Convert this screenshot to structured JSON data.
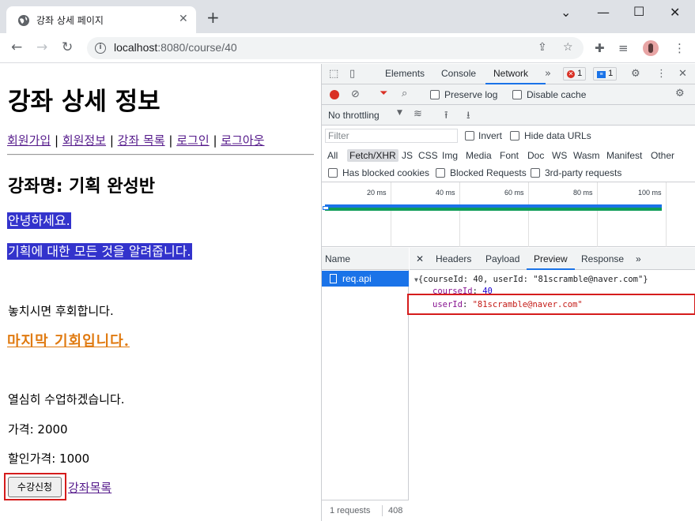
{
  "browser": {
    "tab_title": "강좌 상세 페이지",
    "url_host": "localhost",
    "url_rest": ":8080/course/40"
  },
  "page": {
    "title": "강좌 상세 정보",
    "nav": {
      "signup": "회원가입",
      "member_info": "회원정보",
      "course_list": "강좌 목록",
      "login": "로그인",
      "logout": "로그아웃",
      "separator": "|"
    },
    "course_name": "강좌명: 기획 완성반",
    "desc_line1": "안녕하세요.",
    "desc_line2": "기획에 대한 모든 것을 알려줍니다.",
    "desc_line3": "놓치시면 후회합니다.",
    "desc_emphasis": "마지막 기회입니다.",
    "desc_line4": "열심히 수업하겠습니다.",
    "price": "가격: 2000",
    "sale_price": "할인가격: 1000",
    "apply_button": "수강신청",
    "list_link": "강좌목록"
  },
  "devtools": {
    "tabs": [
      "Elements",
      "Console",
      "Network"
    ],
    "error_count": "1",
    "message_count": "1",
    "preserve_log": "Preserve log",
    "disable_cache": "Disable cache",
    "throttling": "No throttling",
    "filter_placeholder": "Filter",
    "invert": "Invert",
    "hide_data_urls": "Hide data URLs",
    "types": [
      "All",
      "Fetch/XHR",
      "JS",
      "CSS",
      "Img",
      "Media",
      "Font",
      "Doc",
      "WS",
      "Wasm",
      "Manifest",
      "Other"
    ],
    "active_type": "Fetch/XHR",
    "has_blocked_cookies": "Has blocked cookies",
    "blocked_requests": "Blocked Requests",
    "third_party": "3rd-party requests",
    "timeline_ticks": [
      "20 ms",
      "40 ms",
      "60 ms",
      "80 ms",
      "100 ms"
    ],
    "name_header": "Name",
    "request_name": "req.api",
    "footer_requests": "1 requests",
    "footer_size": "408",
    "detail_tabs": [
      "Headers",
      "Payload",
      "Preview",
      "Response"
    ],
    "active_detail_tab": "Preview",
    "preview_root": "{courseId: 40, userId: \"81scramble@naver.com\"}",
    "course_id_key": "courseId",
    "course_id_value": "40",
    "user_id_key": "userId",
    "user_id_value": "\"81scramble@naver.com\""
  },
  "colors": {
    "highlight_bg": "#3333cc",
    "emphasis": "#e07a10",
    "annotation_red": "#d51c1c",
    "devtools_accent": "#1a73e8"
  }
}
